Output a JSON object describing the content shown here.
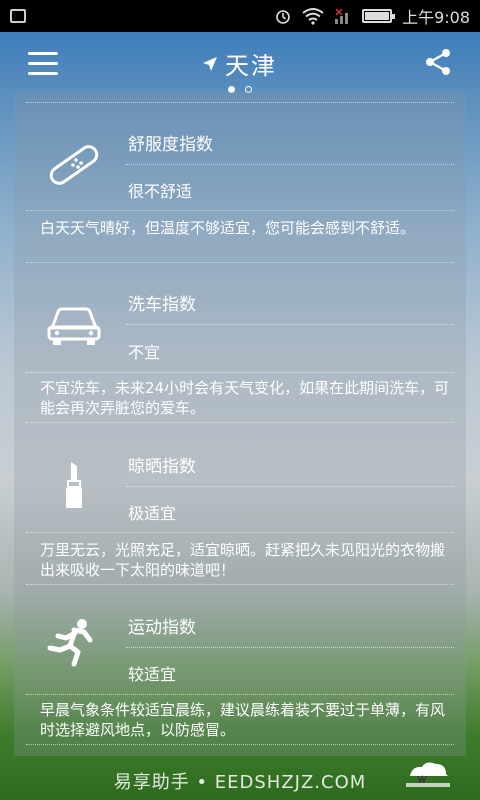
{
  "status_bar": {
    "time": "上午9:08"
  },
  "header": {
    "city": "天津",
    "menu_icon": "menu-icon",
    "share_icon": "share-icon",
    "location_icon": "location-arrow-icon"
  },
  "indices": [
    {
      "icon": "bandage-icon",
      "title": "舒服度指数",
      "value": "很不舒适",
      "description": "白天天气晴好，但温度不够适宜，您可能会感到不舒适。"
    },
    {
      "icon": "car-icon",
      "title": "洗车指数",
      "value": "不宜",
      "description": "不宜洗车，未来24小时会有天气变化，如果在此期间洗车，可能会再次弄脏您的爱车。"
    },
    {
      "icon": "lipstick-icon",
      "title": "晾晒指数",
      "value": "极适宜",
      "description": "万里无云，光照充足，适宜晾晒。赶紧把久未见阳光的衣物搬出来吸收一下太阳的味道吧！"
    },
    {
      "icon": "running-person-icon",
      "title": "运动指数",
      "value": "较适宜",
      "description": "早晨气象条件较适宜晨练，建议晨练着装不要过于单薄，有风时选择避风地点，以防感冒。"
    }
  ],
  "footer": {
    "watermark": "易享助手 • EEDSHZJZ.COM",
    "logo_text": "wunderground.com"
  }
}
